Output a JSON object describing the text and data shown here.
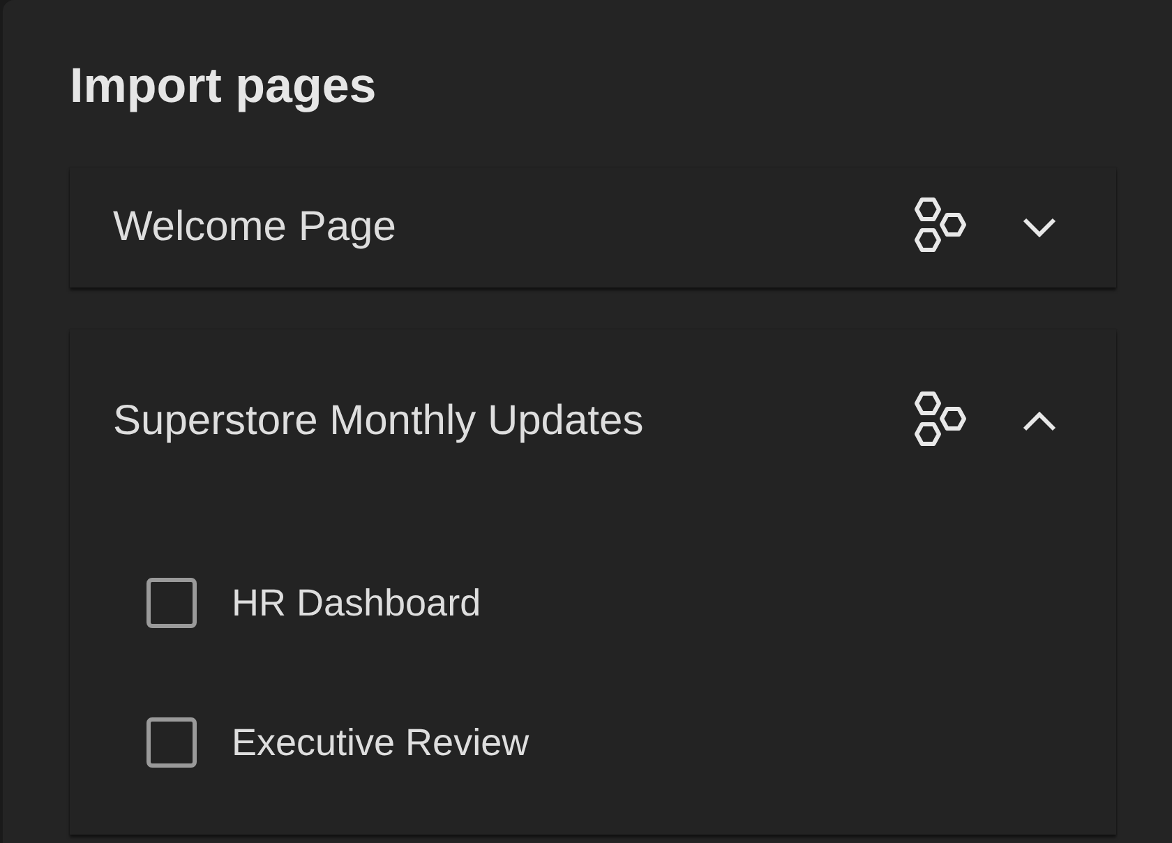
{
  "dialog": {
    "title": "Import pages"
  },
  "pages": [
    {
      "name": "Welcome Page",
      "expanded": false
    },
    {
      "name": "Superstore Monthly Updates",
      "expanded": true,
      "children": [
        {
          "name": "HR Dashboard",
          "checked": false
        },
        {
          "name": "Executive Review",
          "checked": false
        }
      ]
    }
  ]
}
